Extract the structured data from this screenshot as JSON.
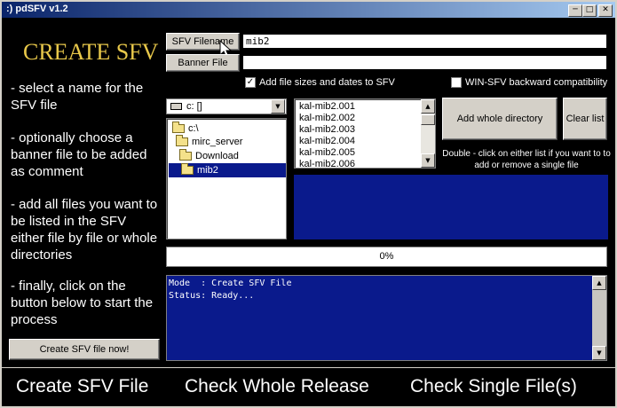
{
  "window": {
    "title": ":) pdSFV v1.2"
  },
  "section_title": "CREATE SFV",
  "help_lines": [
    "- select a name for the SFV file",
    "- optionally choose a banner file to be added as comment",
    "- add all files you want to be listed in the SFV either file by file or whole directories",
    "- finally, click on the button below to start the process"
  ],
  "sfv_filename": {
    "button_label": "SFV Filename",
    "value": "mib2"
  },
  "banner_file": {
    "button_label": "Banner File",
    "value": ""
  },
  "options": {
    "add_sizes_label": "Add file sizes and dates to SFV",
    "add_sizes_checked": true,
    "win_sfv_label": "WIN-SFV backward compatibility",
    "win_sfv_checked": false
  },
  "drive": {
    "selected": "c: []"
  },
  "directories": [
    "c:\\",
    "mirc_server",
    "Download",
    "mib2"
  ],
  "files": [
    "kal-mib2.001",
    "kal-mib2.002",
    "kal-mib2.003",
    "kal-mib2.004",
    "kal-mib2.005",
    "kal-mib2.006"
  ],
  "buttons": {
    "add_directory": "Add whole directory",
    "clear_list": "Clear list",
    "create_now": "Create SFV file now!"
  },
  "hint": "Double - click on either list if you want to  to add or remove a single file",
  "progress": {
    "text": "0%",
    "value": 0
  },
  "log": {
    "line1": "Mode  : Create SFV File",
    "line2": "Status: Ready..."
  },
  "tabs": [
    "Create SFV File",
    "Check Whole Release",
    "Check Single File(s)"
  ],
  "colors": {
    "accent_blue": "#0a1a8c",
    "title_gold": "#e8c84a"
  }
}
